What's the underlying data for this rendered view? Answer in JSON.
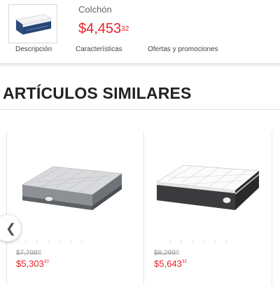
{
  "product": {
    "name": "Colchón",
    "price_main": "$4,453",
    "price_cents": "32",
    "image_icon": "mattress-thumbnail"
  },
  "tabs": [
    {
      "label": "Descripción"
    },
    {
      "label": "Características"
    },
    {
      "label": "Ofertas y promociones"
    }
  ],
  "similar": {
    "title": "ARTÍCULOS SIMILARES",
    "prev_icon": "chevron-left-icon",
    "items": [
      {
        "old_main": "$7,799",
        "old_cents": "00",
        "price_main": "$5,303",
        "price_cents": "32",
        "image_icon": "gray-mattress-image"
      },
      {
        "old_main": "$8,299",
        "old_cents": "00",
        "price_main": "$5,643",
        "price_cents": "32",
        "image_icon": "pillowtop-mattress-image"
      }
    ]
  },
  "colors": {
    "price_red": "#e4242c",
    "old_price": "#999999"
  }
}
